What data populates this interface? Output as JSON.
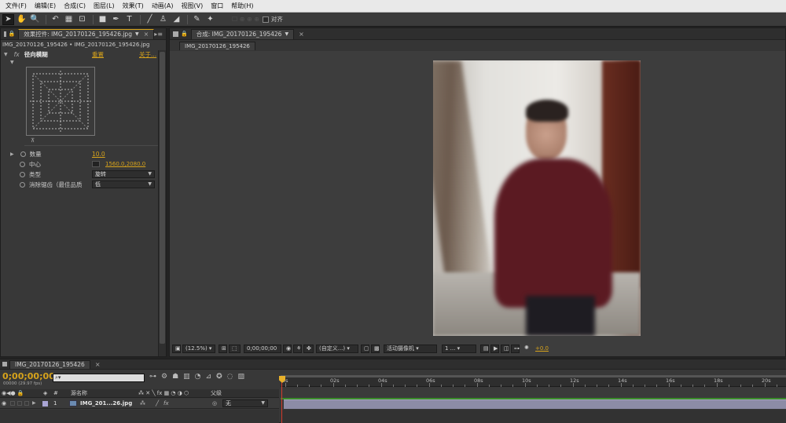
{
  "menu": [
    "文件(F)",
    "编辑(E)",
    "合成(C)",
    "图层(L)",
    "效果(T)",
    "动画(A)",
    "视图(V)",
    "窗口",
    "帮助(H)"
  ],
  "toolbar": {
    "align_label": "对齐",
    "tools": [
      "selection-tool-icon",
      "hand-tool-icon",
      "zoom-tool-icon",
      "rotate-tool-icon",
      "camera-tool-icon",
      "pan-behind-icon",
      "rectangle-tool-icon",
      "pen-tool-icon",
      "text-tool-icon",
      "brush-tool-icon",
      "clone-stamp-icon",
      "eraser-icon",
      "roto-brush-icon",
      "puppet-pin-icon"
    ]
  },
  "effects_panel": {
    "tab_label": "效果控件: IMG_20170126_195426.jpg",
    "breadcrumb": "IMG_20170126_195426 • IMG_20170126_195426.jpg",
    "effect_name": "径向模糊",
    "reset_label": "重置",
    "about_label": "关于...",
    "fx_label": "fx",
    "properties": [
      {
        "label": "数量",
        "value": "10.0"
      },
      {
        "label": "中心",
        "value": "1560.0,2080.0"
      },
      {
        "label": "类型",
        "value": "旋转"
      },
      {
        "label": "消除锯齿（最佳品质",
        "value": "低"
      }
    ]
  },
  "comp_panel": {
    "tab_label": "合成: IMG_20170126_195426",
    "sub_tab": "IMG_20170126_195426",
    "zoom": "(12.5%)",
    "timecode": "0;00;00;00",
    "resolution": "(自定义...)",
    "camera": "活动摄像机",
    "views": "1 ...",
    "exposure": "+0.0"
  },
  "timeline": {
    "tab_label": "IMG_20170126_195426",
    "timecode": "0;00;00;00",
    "frame_info": "00000 (29.97 fps)",
    "search_placeholder": "",
    "col_source": "源名称",
    "col_parent": "父级",
    "layer": {
      "num": "1",
      "name": "IMG_201...26.jpg",
      "parent": "无"
    },
    "ticks": [
      "0s",
      "02s",
      "04s",
      "06s",
      "08s",
      "10s",
      "12s",
      "14s",
      "16s",
      "18s",
      "20s"
    ]
  },
  "colors": {
    "accent": "#d7a31b",
    "timeline_green": "#3a8c2a",
    "layer_bar": "#8c8ca6"
  }
}
